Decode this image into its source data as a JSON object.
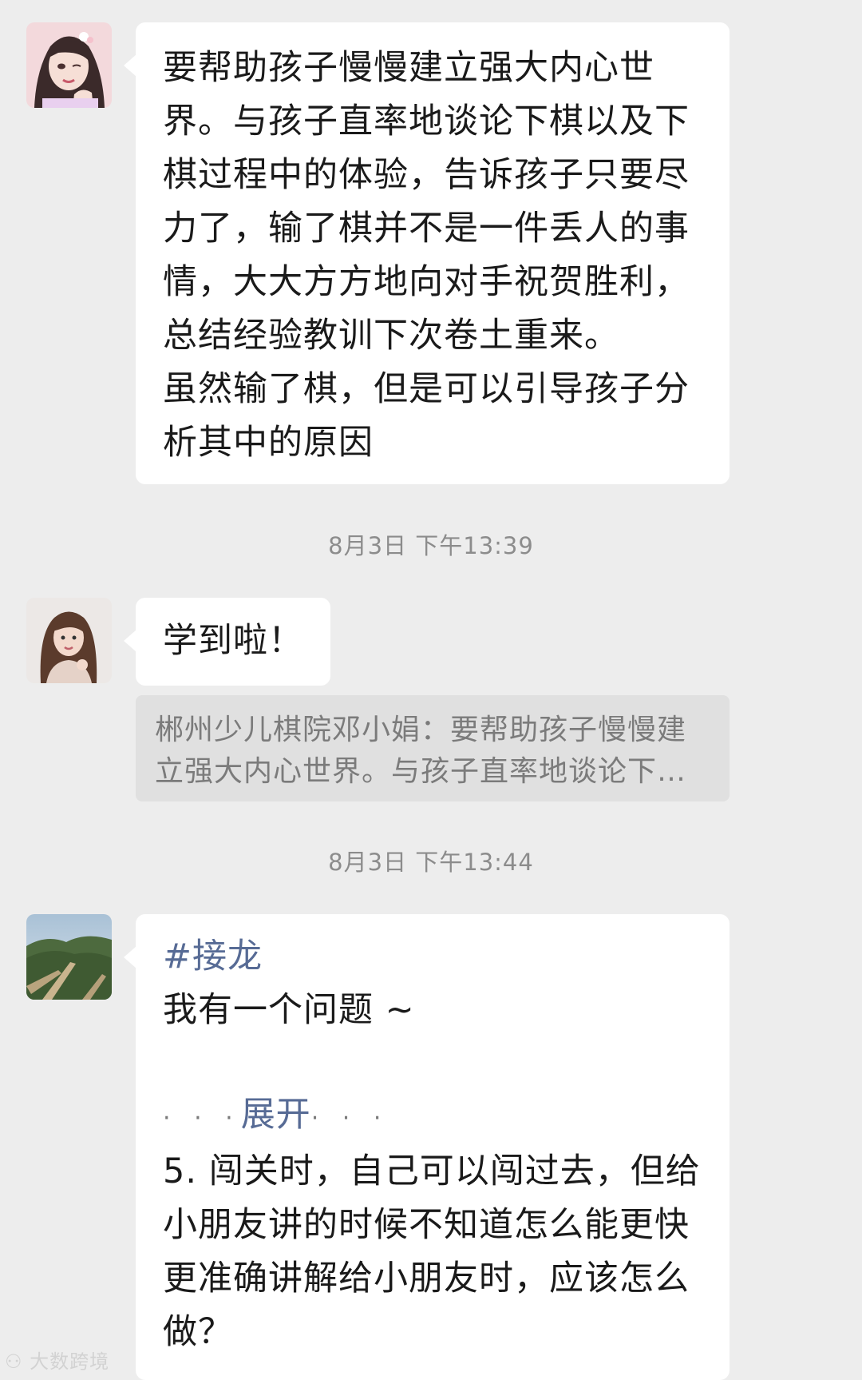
{
  "messages": [
    {
      "avatar": "anime-girl-avatar",
      "text": "要帮助孩子慢慢建立强大内心世界。与孩子直率地谈论下棋以及下棋过程中的体验，告诉孩子只要尽力了，输了棋并不是一件丢人的事情，大大方方地向对手祝贺胜利，总结经验教训下次卷土重来。\n虽然输了棋，但是可以引导孩子分析其中的原因"
    },
    {
      "avatar": "woman-photo-avatar",
      "text": "学到啦！",
      "quote": {
        "line1": "郴州少儿棋院邓小娟：要帮助孩子慢慢建",
        "line2": "立强大内心世界。与孩子直率地谈论下…"
      }
    },
    {
      "avatar": "great-wall-avatar",
      "tag": "#接龙",
      "text": "我有一个问题 ~",
      "expand_label": "展开",
      "expand_dots": "· · ·",
      "text2": "5. 闯关时，自己可以闯过去，但给小朋友讲的时候不知道怎么能更快更准确讲解给小朋友时，应该怎么做？"
    }
  ],
  "timestamps": [
    "8月3日 下午13:39",
    "8月3日 下午13:44"
  ],
  "watermark": "大数跨境",
  "colors": {
    "background": "#ededed",
    "bubble": "#ffffff",
    "quote_bg": "#e0e0e0",
    "link": "#576b95",
    "timestamp": "#8c8c8c"
  }
}
